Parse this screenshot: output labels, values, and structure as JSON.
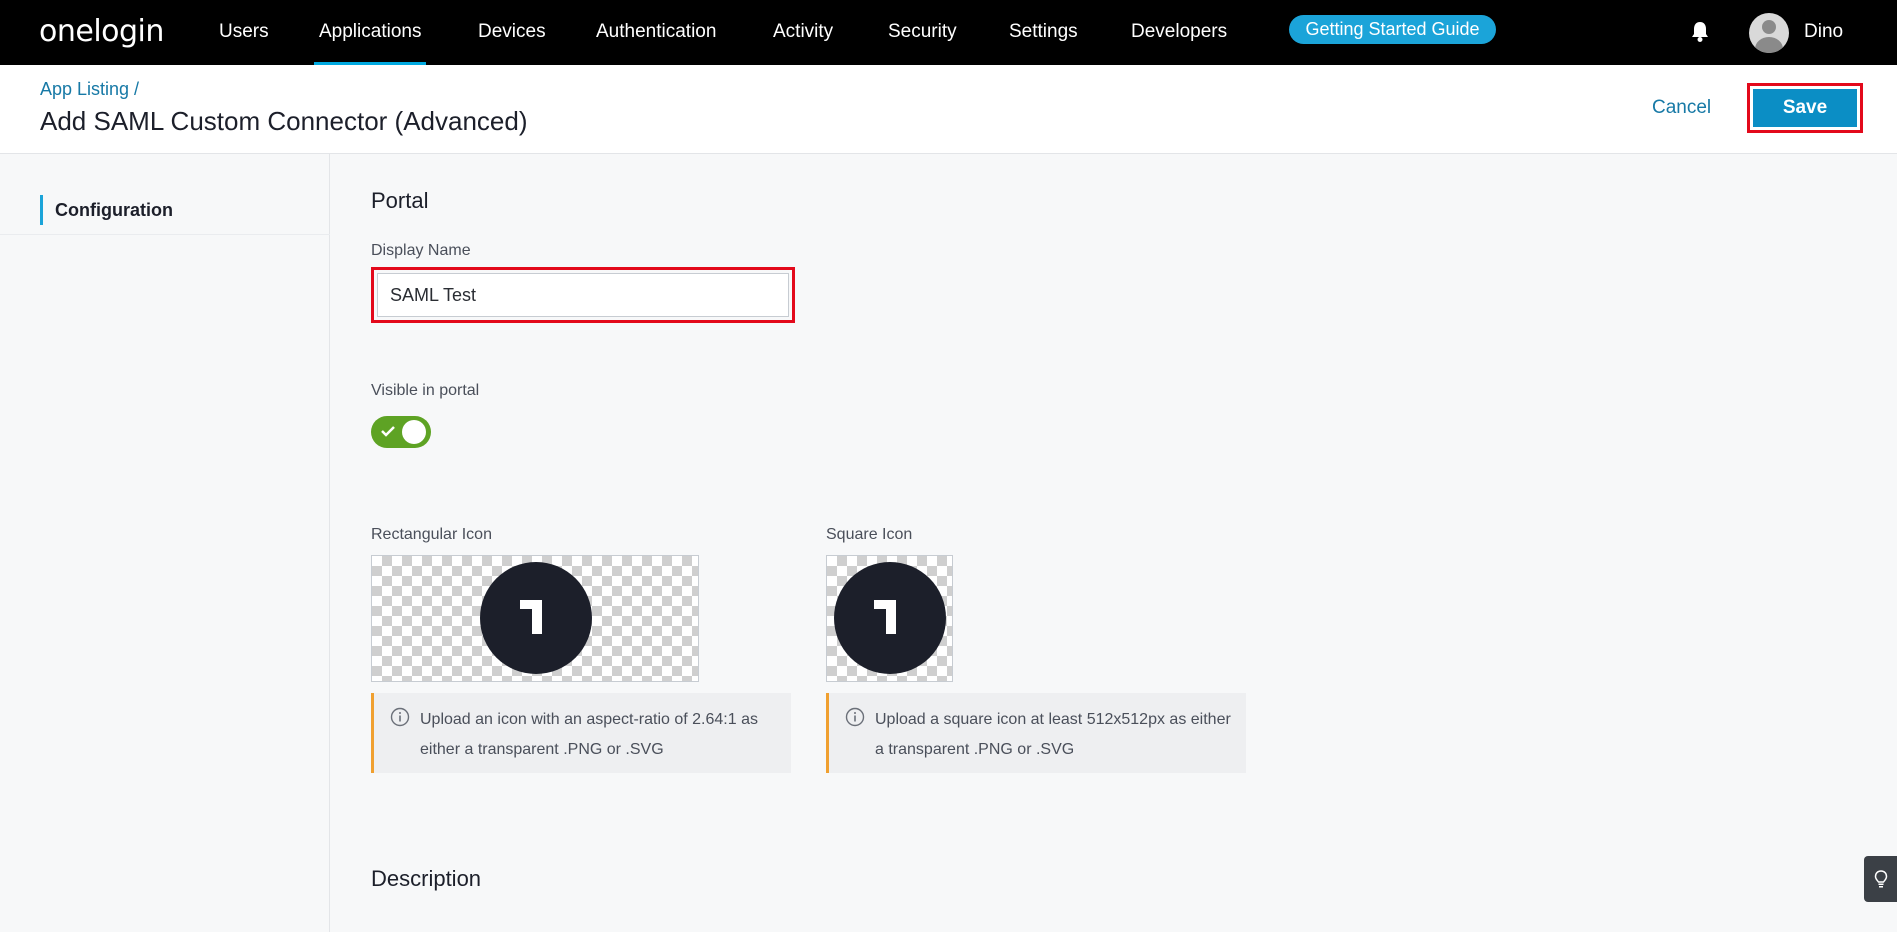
{
  "app": {
    "logo_text": "onelogin"
  },
  "nav": {
    "items": [
      {
        "label": "Users"
      },
      {
        "label": "Applications",
        "active": true
      },
      {
        "label": "Devices"
      },
      {
        "label": "Authentication"
      },
      {
        "label": "Activity"
      },
      {
        "label": "Security"
      },
      {
        "label": "Settings"
      },
      {
        "label": "Developers"
      }
    ],
    "guide_label": "Getting Started Guide",
    "user_name": "Dino"
  },
  "header": {
    "breadcrumb": "App Listing /",
    "title": "Add SAML Custom Connector (Advanced)",
    "cancel_label": "Cancel",
    "save_label": "Save"
  },
  "sidebar": {
    "items": [
      {
        "label": "Configuration"
      }
    ]
  },
  "portal": {
    "section_title": "Portal",
    "display_name_label": "Display Name",
    "display_name_value": "SAML Test",
    "visible_label": "Visible in portal",
    "visible_on": true,
    "rect_icon_label": "Rectangular Icon",
    "square_icon_label": "Square Icon",
    "rect_icon_info": "Upload an icon with an aspect-ratio of 2.64:1 as either a transparent .PNG or .SVG",
    "square_icon_info": "Upload a square icon at least 512x512px as either a transparent .PNG or .SVG",
    "icon_glyph": "1"
  },
  "description": {
    "section_title": "Description"
  },
  "colors": {
    "nav_bg": "#000000",
    "accent": "#1ba4d9",
    "save_bg": "#0b8ec5",
    "toggle_on": "#5ea324",
    "highlight": "#e3091b",
    "link": "#1779a6"
  }
}
